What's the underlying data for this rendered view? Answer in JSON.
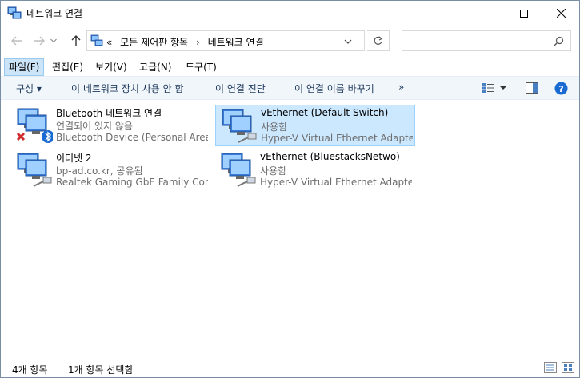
{
  "window": {
    "title": "네트워크 연결"
  },
  "address": {
    "prefix": "«",
    "crumbs": [
      "모든 제어판 항목",
      "네트워크 연결"
    ],
    "separator": "›",
    "search_placeholder": ""
  },
  "menu": {
    "items": [
      "파일(F)",
      "편집(E)",
      "보기(V)",
      "고급(N)",
      "도구(T)"
    ]
  },
  "commands": {
    "organize": "구성 ▾",
    "disable": "이 네트워크 장치 사용 안 함",
    "diagnose": "이 연결 진단",
    "rename": "이 연결 이름 바꾸기",
    "more": "»"
  },
  "connections": [
    {
      "name": "Bluetooth 네트워크 연결",
      "status": "연결되어 있지 않음",
      "device": "Bluetooth Device (Personal Area ...",
      "selected": false,
      "icon": "network-bluetooth-disconnected-icon"
    },
    {
      "name": "vEthernet (Default Switch)",
      "status": "사용함",
      "device": "Hyper-V Virtual Ethernet Adapter",
      "selected": true,
      "icon": "network-cable-icon"
    },
    {
      "name": "이더넷 2",
      "status": "bp-ad.co.kr, 공유됨",
      "device": "Realtek Gaming GbE Family Cont...",
      "selected": false,
      "icon": "network-cable-icon"
    },
    {
      "name": "vEthernet (BluestacksNetwo)",
      "status": "사용함",
      "device": "Hyper-V Virtual Ethernet Adapter...",
      "selected": false,
      "icon": "network-cable-icon"
    }
  ],
  "status": {
    "count": "4개 항목",
    "selected": "1개 항목 선택함"
  },
  "colors": {
    "selection_bg": "#cce8ff",
    "selection_border": "#99d1ff",
    "command_bar": "#f1f6fb",
    "menu_active": "#cce4f7",
    "link_text": "#1e395b",
    "help_blue": "#1a6bd1"
  }
}
